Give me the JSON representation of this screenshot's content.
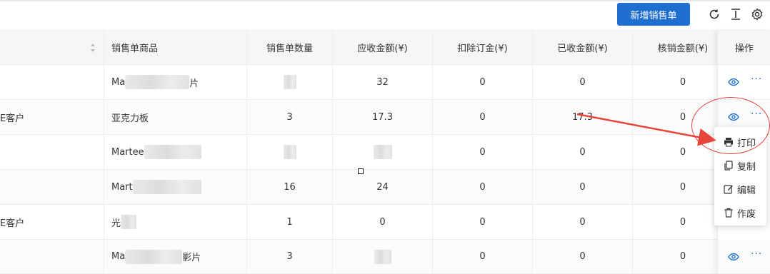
{
  "toolbar": {
    "new_button": "新增销售单",
    "icons": [
      "refresh-icon",
      "column-height-icon",
      "settings-icon"
    ]
  },
  "table": {
    "headers": {
      "product": "销售单商品",
      "quantity": "销售单数量",
      "receivable": "应收金额(¥)",
      "deposit": "扣除订金(¥)",
      "received": "已收金额(¥)",
      "writeoff": "核销金额(¥)",
      "actions": "操作"
    },
    "rows": [
      {
        "customer": "",
        "product_pre": "Ma",
        "product_post": "片",
        "quantity": "",
        "receivable": "32",
        "deposit": "0",
        "received": "0",
        "writeoff": "0"
      },
      {
        "customer": "E客户",
        "product_pre": "亚克力板",
        "product_post": "",
        "quantity": "3",
        "receivable": "17.3",
        "deposit": "0",
        "received": "17.3",
        "writeoff": "0"
      },
      {
        "customer": "",
        "product_pre": "Martee",
        "product_post": "",
        "quantity": "",
        "receivable": "",
        "deposit": "0",
        "received": "0",
        "writeoff": "0"
      },
      {
        "customer": "",
        "product_pre": "Mart",
        "product_post": "",
        "quantity": "16",
        "receivable": "24",
        "deposit": "0",
        "received": "0",
        "writeoff": "0"
      },
      {
        "customer": "E客户",
        "product_pre": "光",
        "product_post": "",
        "quantity": "1",
        "receivable": "0",
        "deposit": "0",
        "received": "0",
        "writeoff": "0"
      },
      {
        "customer": "",
        "product_pre": "Ma",
        "product_post": "影片",
        "quantity": "3",
        "receivable": "",
        "deposit": "0",
        "received": "0",
        "writeoff": "0"
      }
    ]
  },
  "dropdown": {
    "items": [
      {
        "label": "打印",
        "icon": "printer-icon"
      },
      {
        "label": "复制",
        "icon": "copy-icon"
      },
      {
        "label": "编辑",
        "icon": "edit-icon"
      },
      {
        "label": "作废",
        "icon": "delete-icon"
      }
    ]
  },
  "colors": {
    "primary": "#1f6fd1",
    "annotation": "#e8443a"
  }
}
